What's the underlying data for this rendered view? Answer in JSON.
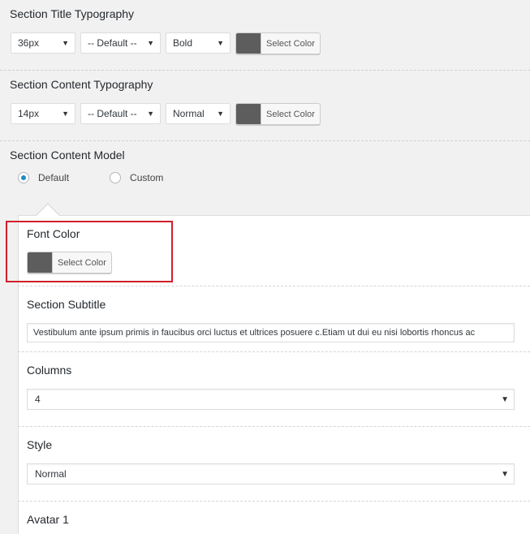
{
  "title_typography": {
    "label": "Section Title Typography",
    "size": "36px",
    "family": "-- Default --",
    "weight": "Bold",
    "color_button": "Select Color"
  },
  "content_typography": {
    "label": "Section Content Typography",
    "size": "14px",
    "family": "-- Default --",
    "weight": "Normal",
    "color_button": "Select Color"
  },
  "content_model": {
    "label": "Section Content Model",
    "options": [
      "Default",
      "Custom"
    ],
    "selected": "Default"
  },
  "panel": {
    "font_color": {
      "label": "Font Color",
      "button": "Select Color",
      "swatch": "#5d5d5d"
    },
    "subtitle": {
      "label": "Section Subtitle",
      "value": "Vestibulum ante ipsum primis in faucibus orci luctus et ultrices posuere c.Etiam ut dui eu nisi lobortis rhoncus ac"
    },
    "columns": {
      "label": "Columns",
      "value": "4"
    },
    "style": {
      "label": "Style",
      "value": "Normal"
    },
    "avatar": {
      "label": "Avatar 1"
    }
  },
  "colors": {
    "accent": "#1e8cbe",
    "highlight": "#d0202a",
    "swatch": "#5d5d5d"
  },
  "icons": {
    "dropdown": "▼"
  }
}
